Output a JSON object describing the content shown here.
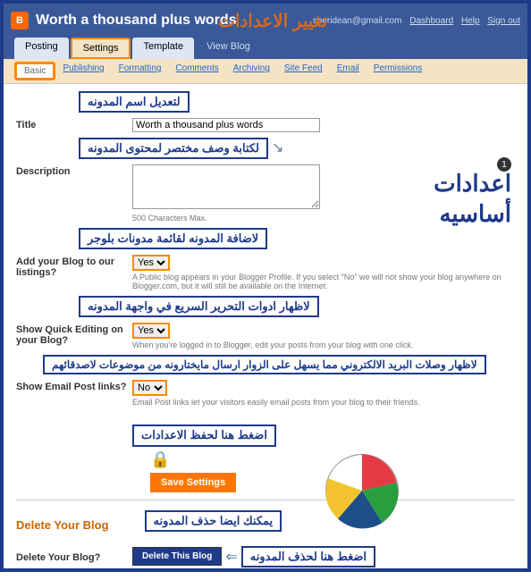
{
  "top": {
    "title": "Worth a thousand plus words",
    "arabic": "تغيير الاعدادات",
    "email": "sheridean@gmail.com",
    "dashboard": "Dashboard",
    "help": "Help",
    "signout": "Sign out"
  },
  "tabs": {
    "posting": "Posting",
    "settings": "Settings",
    "template": "Template",
    "viewblog": "View Blog"
  },
  "subtabs": {
    "basic": "Basic",
    "publishing": "Publishing",
    "formatting": "Formatting",
    "comments": "Comments",
    "archiving": "Archiving",
    "sitefeed": "Site Feed",
    "email": "Email",
    "permissions": "Permissions"
  },
  "side": {
    "num": "1",
    "line1": "اعدادات",
    "line2": "أساسيه"
  },
  "ann": {
    "title": "لتعديل اسم المدونه",
    "desc": "لكتابة وصف مختصر لمحتوى المدونه",
    "listing": "لاضافة المدونه لقائمة مدونات بلوجر",
    "quickedit": "لاظهار ادوات التحرير السريع في واجهة المدونه",
    "emaillinks": "لاظهار وصلات البريد الالكتروني مما يسهل على الزوار ارسال  مايختارونه من موضوعات لاصدقائهم",
    "save": "اضغط هنا لحفظ الاعدادات",
    "deletesection": "يمكنك ايضا حذف المدونه",
    "deletebtn": "اضغط هنا لحذف المدونه"
  },
  "labels": {
    "title": "Title",
    "description": "Description",
    "chars": "500 Characters Max.",
    "addlisting": "Add your Blog to our listings?",
    "listinghint": "A Public blog appears in your Blogger Profile. If you select \"No\" we will not show your blog anywhere on Blogger.com, but it will still be available on the Internet.",
    "quickedit": "Show Quick Editing on your Blog?",
    "quickedithint": "When you're logged in to Blogger, edit your posts from your blog with one click.",
    "emaillinks": "Show Email Post links?",
    "emaillinkshint": "Email Post links let your visitors easily email posts from your blog to their friends.",
    "savebtn": "Save Settings",
    "deleteheader": "Delete Your Blog",
    "deleteq": "Delete Your Blog?",
    "deletebtn": "Delete This Blog"
  },
  "values": {
    "title": "Worth a thousand plus words",
    "listing": "Yes",
    "quickedit": "Yes",
    "emaillinks": "No"
  }
}
